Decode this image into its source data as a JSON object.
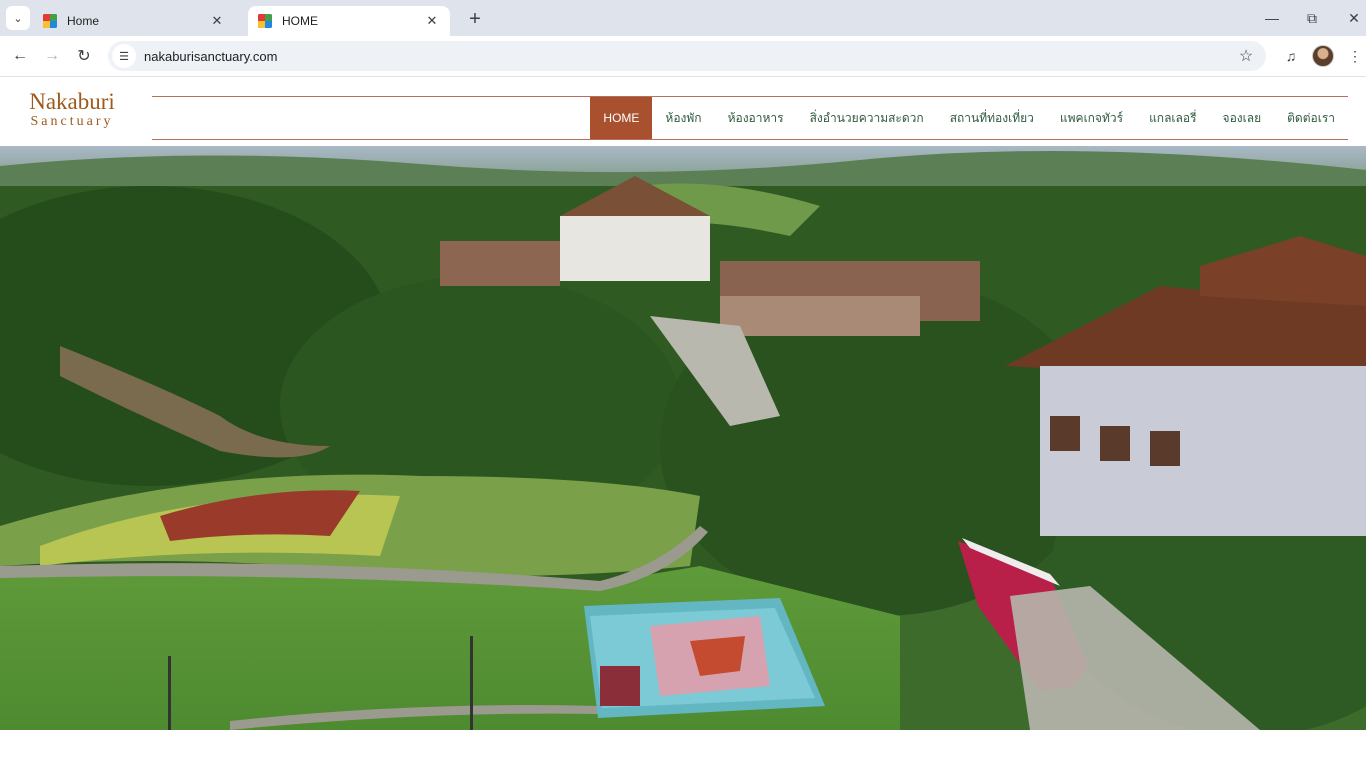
{
  "browser": {
    "tabs": [
      {
        "title": "Home",
        "active": false
      },
      {
        "title": "HOME",
        "active": true
      }
    ],
    "url": "nakaburisanctuary.com",
    "icons": {
      "tab_search": "chevron-down-icon",
      "close": "close-icon",
      "new_tab": "plus-icon",
      "back": "arrow-left-icon",
      "forward": "arrow-right-icon",
      "reload": "reload-icon",
      "site_info": "tune-icon",
      "bookmark": "star-icon",
      "media": "media-controls-icon",
      "menu": "kebab-menu-icon"
    }
  },
  "site": {
    "logo": {
      "main": "Nakaburi",
      "sub": "Sanctuary"
    },
    "menu": [
      {
        "label": "HOME",
        "active": true
      },
      {
        "label": "ห้องพัก",
        "active": false
      },
      {
        "label": "ห้องอาหาร",
        "active": false
      },
      {
        "label": "สิ่งอำนวยความสะดวก",
        "active": false
      },
      {
        "label": "สถานที่ท่องเที่ยว",
        "active": false
      },
      {
        "label": "แพคเกจทัวร์",
        "active": false
      },
      {
        "label": "แกลเลอรี่",
        "active": false
      },
      {
        "label": "จองเลย",
        "active": false
      },
      {
        "label": "ติดต่อเรา",
        "active": false
      }
    ],
    "colors": {
      "brand": "#9c5a1c",
      "menu_active_bg": "#a9512f",
      "menu_text": "#2f5b41",
      "nav_border": "#b6705d"
    }
  }
}
